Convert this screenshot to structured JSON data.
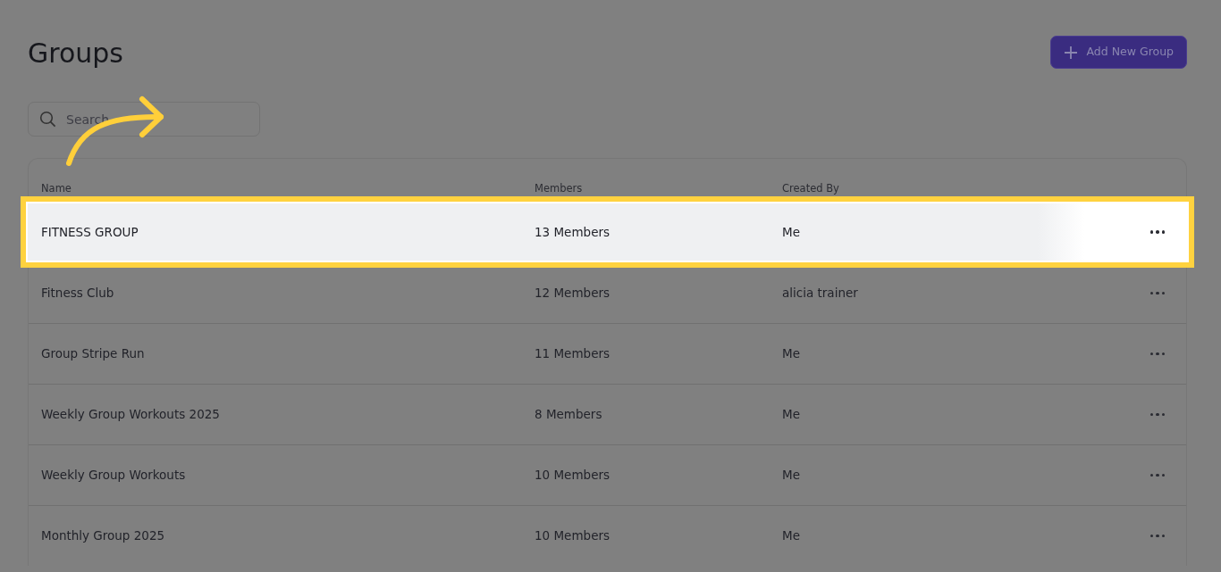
{
  "page": {
    "title": "Groups"
  },
  "add_button": {
    "label": "Add New Group"
  },
  "search": {
    "placeholder": "Search"
  },
  "table": {
    "columns": [
      "Name",
      "Members",
      "Created By"
    ],
    "rows": [
      {
        "name": "FITNESS GROUP",
        "members": "13 Members",
        "created_by": "Me",
        "selected": true
      },
      {
        "name": "Fitness Club",
        "members": "12 Members",
        "created_by": "alicia trainer",
        "selected": false
      },
      {
        "name": "Group Stripe Run",
        "members": "11 Members",
        "created_by": "Me",
        "selected": false
      },
      {
        "name": "Weekly Group Workouts 2025",
        "members": "8 Members",
        "created_by": "Me",
        "selected": false
      },
      {
        "name": "Weekly Group Workouts",
        "members": "10 Members",
        "created_by": "Me",
        "selected": false
      },
      {
        "name": "Monthly Group 2025",
        "members": "10 Members",
        "created_by": "Me",
        "selected": false
      }
    ]
  }
}
